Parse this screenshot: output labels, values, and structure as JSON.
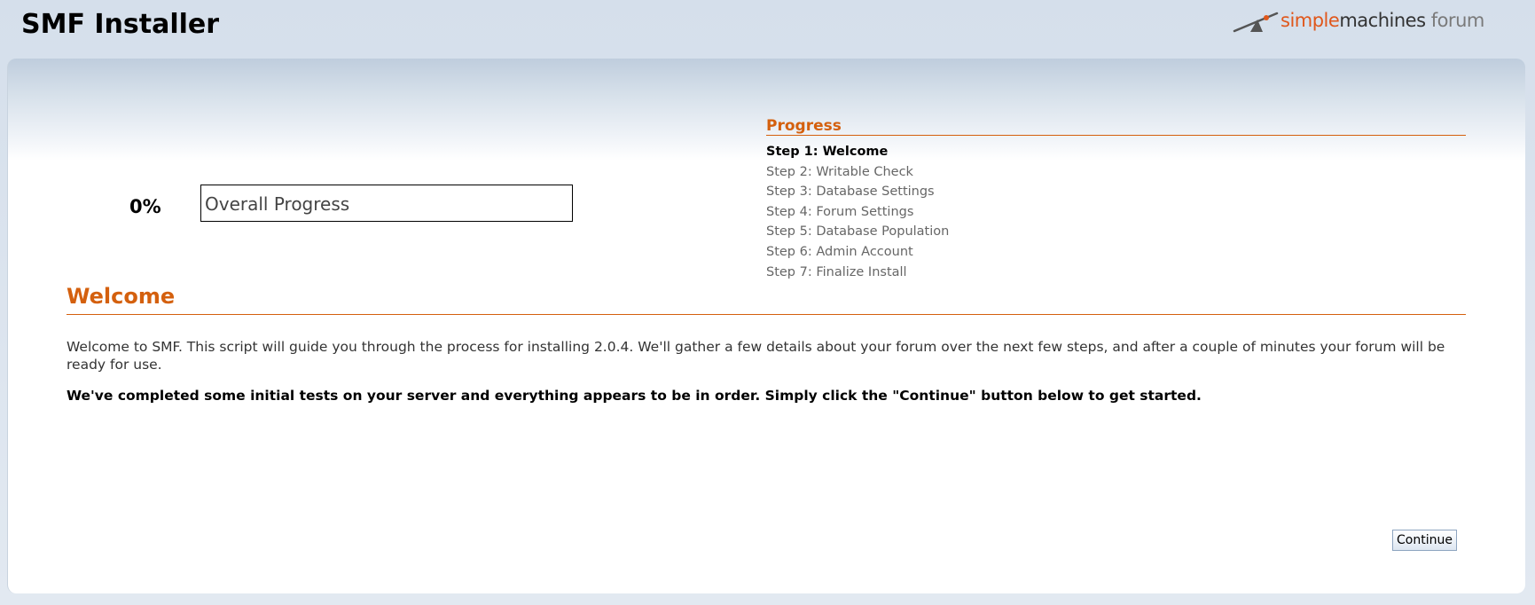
{
  "app": {
    "title": "SMF Installer"
  },
  "logo": {
    "text_part1": "simple",
    "text_part2": "machines",
    "text_part3": " forum",
    "icon": "seesaw-logo-icon"
  },
  "progress": {
    "percent_text": "0%",
    "overall_value": 0,
    "bar_label": "Overall Progress",
    "heading": "Progress",
    "steps": [
      {
        "label": "Step 1: Welcome",
        "current": true
      },
      {
        "label": "Step 2: Writable Check",
        "current": false
      },
      {
        "label": "Step 3: Database Settings",
        "current": false
      },
      {
        "label": "Step 4: Forum Settings",
        "current": false
      },
      {
        "label": "Step 5: Database Population",
        "current": false
      },
      {
        "label": "Step 6: Admin Account",
        "current": false
      },
      {
        "label": "Step 7: Finalize Install",
        "current": false
      }
    ]
  },
  "content": {
    "heading": "Welcome",
    "intro": "Welcome to SMF. This script will guide you through the process for installing 2.0.4. We'll gather a few details about your forum over the next few steps, and after a couple of minutes your forum will be ready for use.",
    "status": "We've completed some initial tests on your server and everything appears to be in order. Simply click the \"Continue\" button below to get started."
  },
  "actions": {
    "continue_label": "Continue"
  },
  "colors": {
    "accent": "#d4600e",
    "background": "#d9e2ec"
  }
}
